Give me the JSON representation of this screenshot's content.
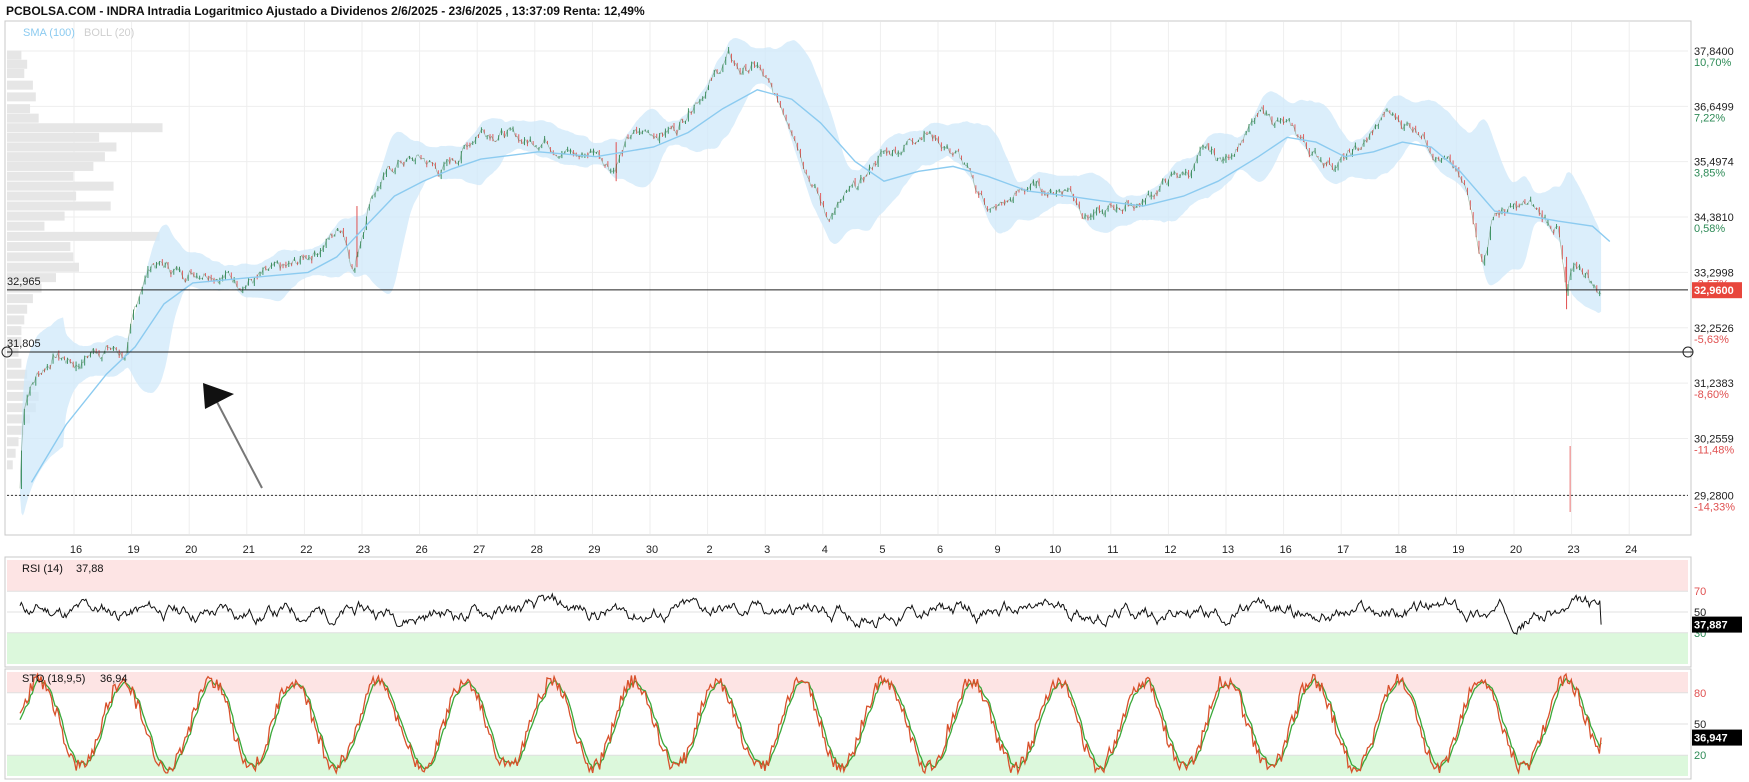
{
  "header": {
    "title": "PCBOLSA.COM - INDRA Intradia Logaritmico Ajustado a Dividenos 2/6/2025 - 23/6/2025 , 13:37:09 Renta: 12,49%"
  },
  "legend": {
    "sma_label": "SMA (100)",
    "boll_label": "BOLL (20)"
  },
  "colors": {
    "up": "#2e8b57",
    "down": "#e05050",
    "sma": "#8ccbf0",
    "boll_fill": "#cfe8fa",
    "rsi_line": "#111111",
    "sto_k": "#d8502a",
    "sto_d": "#3aa83a",
    "overbought_zone": "#fde4e4",
    "oversold_zone": "#dcf8dc",
    "price_badge": "#e8463c"
  },
  "chart_data": {
    "type": "line",
    "subtype": "candlestick-intraday",
    "scale": "log",
    "ylim": [
      29.0,
      38.3
    ],
    "x_tick_labels": [
      "16",
      "19",
      "20",
      "21",
      "22",
      "23",
      "26",
      "27",
      "28",
      "29",
      "30",
      "2",
      "3",
      "4",
      "5",
      "6",
      "9",
      "10",
      "11",
      "12",
      "13",
      "16",
      "17",
      "18",
      "19",
      "20",
      "23",
      "24"
    ],
    "y_axis": [
      {
        "price": "37,8400",
        "pct": "10,70%",
        "value": 37.84,
        "sign": "pos"
      },
      {
        "price": "36,6499",
        "pct": "7,22%",
        "value": 36.6499,
        "sign": "pos"
      },
      {
        "price": "35,4974",
        "pct": "3,85%",
        "value": 35.4974,
        "sign": "pos"
      },
      {
        "price": "34,3810",
        "pct": "0,58%",
        "value": 34.381,
        "sign": "pos"
      },
      {
        "price": "33,2998",
        "pct": "-2,57%",
        "value": 33.2998,
        "sign": "neg"
      },
      {
        "price": "32,2526",
        "pct": "-5,63%",
        "value": 32.2526,
        "sign": "neg"
      },
      {
        "price": "31,2383",
        "pct": "-8,60%",
        "value": 31.2383,
        "sign": "neg"
      },
      {
        "price": "30,2559",
        "pct": "-11,48%",
        "value": 30.2559,
        "sign": "neg"
      },
      {
        "price": "29,2800",
        "pct": "-14,33%",
        "value": 29.28,
        "sign": "neg"
      }
    ],
    "horizontal_lines": [
      {
        "label": "32,965",
        "value": 32.965
      },
      {
        "label": "31,805",
        "value": 31.805
      }
    ],
    "dotted_line": {
      "value": 29.28
    },
    "current_price": {
      "label": "32,9600",
      "value": 32.96
    },
    "price_path": [
      [
        0,
        29.4
      ],
      [
        0.06,
        30.8
      ],
      [
        0.15,
        31.15
      ],
      [
        0.3,
        31.4
      ],
      [
        0.6,
        31.75
      ],
      [
        1.0,
        31.6
      ],
      [
        1.3,
        31.85
      ],
      [
        1.55,
        31.9
      ],
      [
        1.85,
        31.75
      ],
      [
        2.1,
        33.0
      ],
      [
        2.3,
        33.5
      ],
      [
        2.8,
        33.3
      ],
      [
        3.3,
        33.4
      ],
      [
        3.8,
        33.15
      ],
      [
        4.2,
        33.2
      ],
      [
        4.7,
        33.35
      ],
      [
        5.2,
        33.8
      ],
      [
        5.6,
        34.2
      ],
      [
        5.8,
        33.4
      ],
      [
        6.1,
        34.9
      ],
      [
        6.6,
        35.5
      ],
      [
        7.0,
        35.55
      ],
      [
        7.3,
        35.3
      ],
      [
        7.6,
        35.6
      ],
      [
        8.0,
        36.2
      ],
      [
        8.4,
        36.1
      ],
      [
        8.8,
        35.9
      ],
      [
        9.1,
        36.0
      ],
      [
        9.4,
        35.8
      ],
      [
        9.7,
        35.6
      ],
      [
        10.0,
        35.75
      ],
      [
        10.3,
        35.4
      ],
      [
        10.6,
        36.0
      ],
      [
        11.0,
        36.1
      ],
      [
        11.4,
        36.2
      ],
      [
        11.7,
        36.8
      ],
      [
        12.0,
        37.2
      ],
      [
        12.3,
        37.7
      ],
      [
        12.5,
        37.4
      ],
      [
        12.8,
        37.5
      ],
      [
        13.1,
        36.8
      ],
      [
        13.4,
        36.3
      ],
      [
        13.7,
        35.3
      ],
      [
        14.0,
        34.4
      ],
      [
        14.3,
        34.7
      ],
      [
        14.6,
        35.0
      ],
      [
        14.9,
        35.6
      ],
      [
        15.3,
        35.8
      ],
      [
        15.7,
        36.2
      ],
      [
        16.0,
        35.9
      ],
      [
        16.3,
        35.6
      ],
      [
        16.6,
        34.9
      ],
      [
        16.9,
        34.5
      ],
      [
        17.2,
        34.7
      ],
      [
        17.5,
        35.0
      ],
      [
        17.9,
        34.9
      ],
      [
        18.2,
        35.0
      ],
      [
        18.5,
        34.5
      ],
      [
        18.8,
        34.4
      ],
      [
        19.1,
        34.6
      ],
      [
        19.5,
        34.7
      ],
      [
        19.9,
        35.1
      ],
      [
        20.3,
        35.3
      ],
      [
        20.6,
        35.7
      ],
      [
        20.9,
        35.5
      ],
      [
        21.2,
        36.0
      ],
      [
        21.6,
        36.5
      ],
      [
        21.9,
        36.3
      ],
      [
        22.2,
        36.0
      ],
      [
        22.5,
        35.6
      ],
      [
        22.8,
        35.5
      ],
      [
        23.1,
        35.6
      ],
      [
        23.4,
        35.9
      ],
      [
        23.7,
        36.5
      ],
      [
        24.0,
        36.3
      ],
      [
        24.3,
        36.2
      ],
      [
        24.6,
        35.7
      ],
      [
        24.9,
        35.3
      ],
      [
        25.2,
        34.6
      ],
      [
        25.4,
        33.5
      ],
      [
        25.6,
        34.5
      ],
      [
        25.9,
        34.5
      ],
      [
        26.2,
        34.6
      ],
      [
        26.5,
        34.3
      ],
      [
        26.7,
        34.2
      ],
      [
        26.85,
        32.8
      ],
      [
        27.0,
        33.4
      ],
      [
        27.2,
        33.3
      ],
      [
        27.35,
        33.0
      ],
      [
        27.45,
        32.96
      ]
    ],
    "sma_path": [
      [
        0.2,
        29.5
      ],
      [
        0.8,
        30.5
      ],
      [
        1.5,
        31.4
      ],
      [
        2.0,
        31.9
      ],
      [
        2.5,
        32.7
      ],
      [
        3.0,
        33.1
      ],
      [
        4.0,
        33.2
      ],
      [
        5.0,
        33.3
      ],
      [
        5.5,
        33.6
      ],
      [
        6.0,
        34.2
      ],
      [
        6.5,
        34.8
      ],
      [
        7.0,
        35.1
      ],
      [
        7.5,
        35.35
      ],
      [
        8.0,
        35.55
      ],
      [
        9.0,
        35.7
      ],
      [
        10.0,
        35.6
      ],
      [
        11.0,
        35.8
      ],
      [
        11.6,
        36.1
      ],
      [
        12.2,
        36.6
      ],
      [
        12.8,
        37.0
      ],
      [
        13.4,
        36.8
      ],
      [
        13.9,
        36.3
      ],
      [
        14.5,
        35.5
      ],
      [
        15.0,
        35.1
      ],
      [
        15.6,
        35.3
      ],
      [
        16.2,
        35.4
      ],
      [
        16.8,
        35.2
      ],
      [
        17.5,
        34.9
      ],
      [
        18.2,
        34.8
      ],
      [
        18.8,
        34.7
      ],
      [
        19.5,
        34.6
      ],
      [
        20.2,
        34.8
      ],
      [
        20.8,
        35.1
      ],
      [
        21.5,
        35.6
      ],
      [
        22.0,
        36.0
      ],
      [
        22.5,
        35.9
      ],
      [
        23.0,
        35.6
      ],
      [
        23.5,
        35.7
      ],
      [
        24.0,
        35.9
      ],
      [
        24.5,
        35.8
      ],
      [
        25.0,
        35.3
      ],
      [
        25.6,
        34.5
      ],
      [
        26.2,
        34.4
      ],
      [
        26.7,
        34.3
      ],
      [
        27.3,
        34.2
      ],
      [
        27.6,
        33.9
      ]
    ],
    "volume_profile": [
      {
        "value": 37.75,
        "length": 0.25
      },
      {
        "value": 37.55,
        "length": 0.35
      },
      {
        "value": 37.35,
        "length": 0.3
      },
      {
        "value": 37.1,
        "length": 0.45
      },
      {
        "value": 36.85,
        "length": 0.5
      },
      {
        "value": 36.6,
        "length": 0.4
      },
      {
        "value": 36.4,
        "length": 0.55
      },
      {
        "value": 36.2,
        "length": 2.7
      },
      {
        "value": 36.0,
        "length": 1.6
      },
      {
        "value": 35.8,
        "length": 1.9
      },
      {
        "value": 35.6,
        "length": 1.7
      },
      {
        "value": 35.4,
        "length": 1.5
      },
      {
        "value": 35.2,
        "length": 1.15
      },
      {
        "value": 35.0,
        "length": 1.85
      },
      {
        "value": 34.8,
        "length": 1.2
      },
      {
        "value": 34.6,
        "length": 1.8
      },
      {
        "value": 34.4,
        "length": 1.0
      },
      {
        "value": 34.2,
        "length": 0.65
      },
      {
        "value": 34.0,
        "length": 2.65
      },
      {
        "value": 33.8,
        "length": 1.1
      },
      {
        "value": 33.6,
        "length": 1.15
      },
      {
        "value": 33.4,
        "length": 1.25
      },
      {
        "value": 33.2,
        "length": 0.85
      },
      {
        "value": 33.0,
        "length": 0.6
      },
      {
        "value": 32.8,
        "length": 0.45
      },
      {
        "value": 32.6,
        "length": 0.35
      },
      {
        "value": 32.4,
        "length": 0.3
      },
      {
        "value": 32.2,
        "length": 0.25
      },
      {
        "value": 32.0,
        "length": 0.25
      },
      {
        "value": 31.8,
        "length": 0.2
      },
      {
        "value": 31.6,
        "length": 0.25
      },
      {
        "value": 31.4,
        "length": 0.35
      },
      {
        "value": 31.2,
        "length": 0.5
      },
      {
        "value": 31.0,
        "length": 0.55
      },
      {
        "value": 30.8,
        "length": 0.5
      },
      {
        "value": 30.6,
        "length": 0.4
      },
      {
        "value": 30.4,
        "length": 0.3
      },
      {
        "value": 30.2,
        "length": 0.2
      },
      {
        "value": 30.0,
        "length": 0.15
      },
      {
        "value": 29.8,
        "length": 0.1
      }
    ],
    "volume_spikes": [
      {
        "x": 26.9,
        "value": 0.6
      }
    ],
    "rsi": {
      "label": "RSI (14)",
      "value_text": "37,88",
      "badge": "37,887",
      "ylim": [
        0,
        100
      ],
      "levels": [
        70,
        50,
        30
      ],
      "level_labels": [
        "70",
        "50",
        "30"
      ],
      "last": 37.887
    },
    "sto": {
      "label": "STO (18,9,5)",
      "value_text": "36,94",
      "badge": "36,947",
      "ylim": [
        0,
        100
      ],
      "levels": [
        80,
        50,
        20
      ],
      "level_labels": [
        "80",
        "50",
        "20"
      ],
      "last": 36.947
    }
  }
}
